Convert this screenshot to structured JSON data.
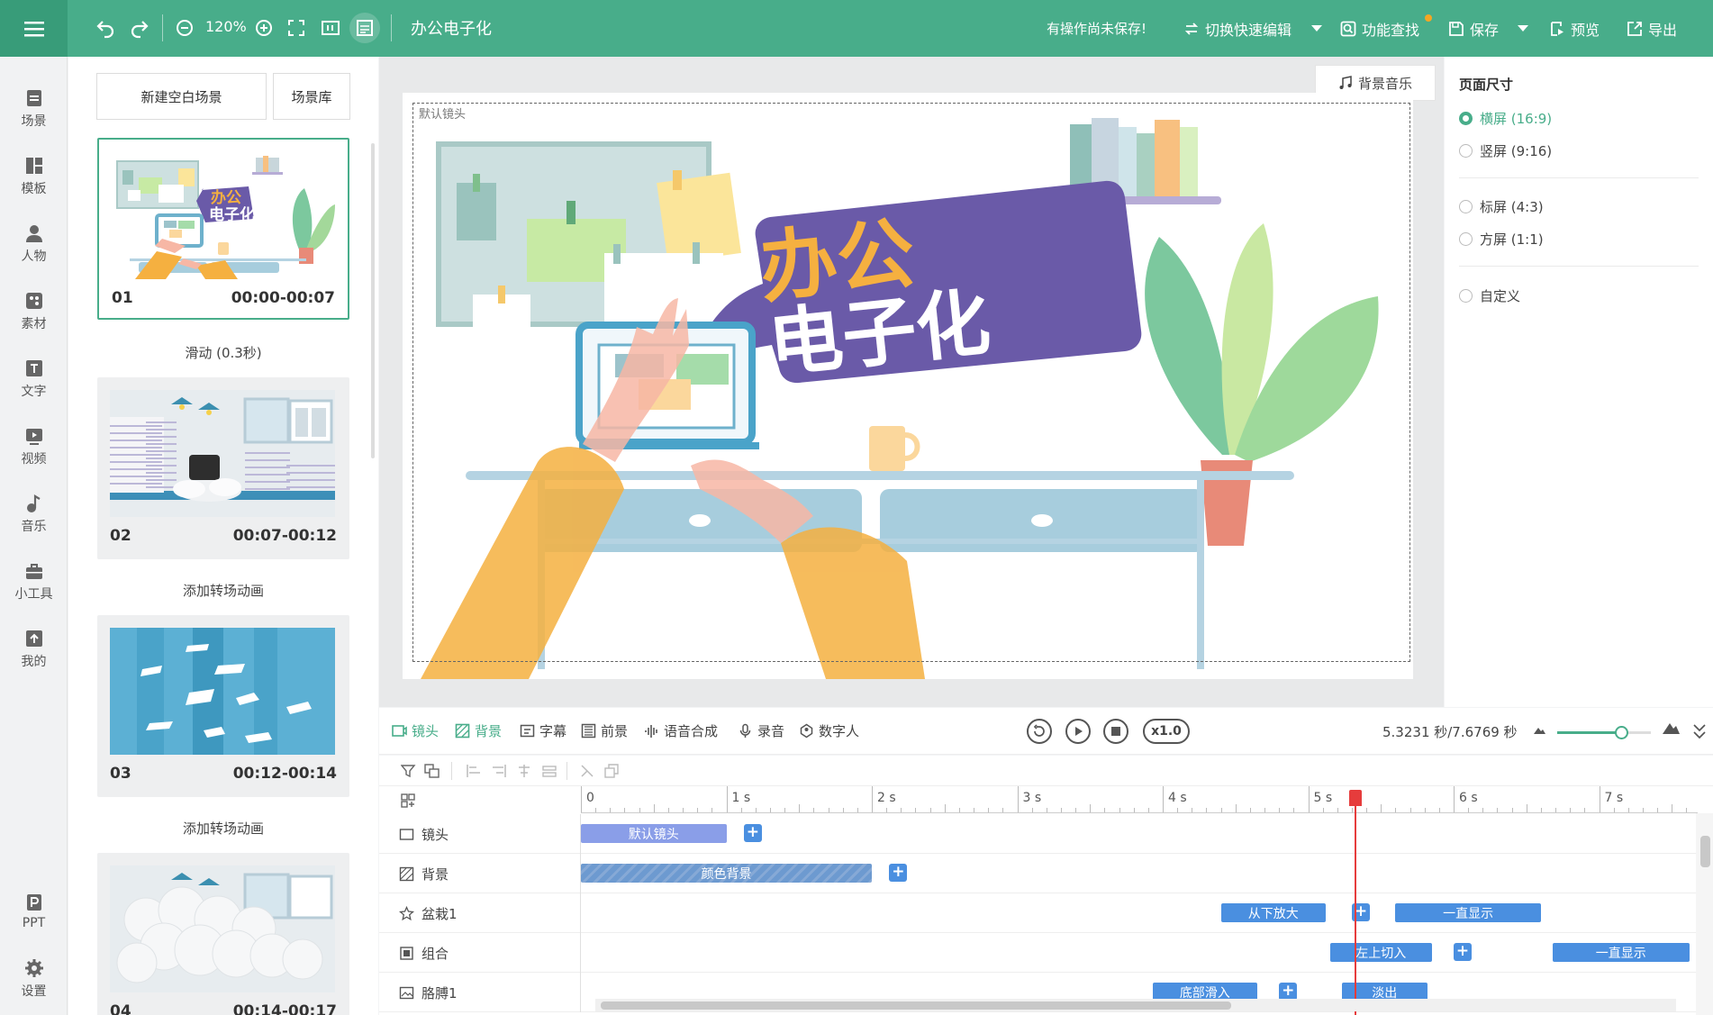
{
  "topbar": {
    "zoom": "120%",
    "doc_title": "办公电子化",
    "unsaved_notice": "有操作尚未保存!",
    "switch_label": "切换快速编辑",
    "find_label": "功能查找",
    "save_label": "保存",
    "preview_label": "预览",
    "export_label": "导出"
  },
  "nav": {
    "items": [
      {
        "label": "场景",
        "icon": "scene-icon"
      },
      {
        "label": "模板",
        "icon": "template-icon"
      },
      {
        "label": "人物",
        "icon": "person-icon"
      },
      {
        "label": "素材",
        "icon": "material-icon"
      },
      {
        "label": "文字",
        "icon": "text-icon"
      },
      {
        "label": "视频",
        "icon": "video-icon"
      },
      {
        "label": "音乐",
        "icon": "music-icon"
      },
      {
        "label": "小工具",
        "icon": "toolbox-icon"
      },
      {
        "label": "我的",
        "icon": "upload-icon"
      }
    ],
    "bottom": [
      {
        "label": "PPT",
        "icon": "ppt-icon"
      },
      {
        "label": "设置",
        "icon": "gear-icon"
      }
    ]
  },
  "scenes": {
    "new_blank": "新建空白场景",
    "library": "场景库",
    "cards": [
      {
        "num": "01",
        "time": "00:00-00:07",
        "transition": "滑动 (0.3秒)"
      },
      {
        "num": "02",
        "time": "00:07-00:12",
        "transition": "添加转场动画"
      },
      {
        "num": "03",
        "time": "00:12-00:14",
        "transition": "添加转场动画"
      },
      {
        "num": "04",
        "time": "00:14-00:17",
        "transition": ""
      }
    ],
    "thumb1_title_line1": "办公",
    "thumb1_title_line2": "电子化"
  },
  "canvas": {
    "bg_music": "背景音乐",
    "lens_label": "默认镜头",
    "title_line1": "办公",
    "title_line2": "电子化"
  },
  "page_size": {
    "title": "页面尺寸",
    "options": [
      {
        "label": "横屏 (16:9)",
        "selected": true
      },
      {
        "label": "竖屏 (9:16)",
        "selected": false
      },
      {
        "label": "标屏 (4:3)",
        "selected": false
      },
      {
        "label": "方屏 (1:1)",
        "selected": false
      },
      {
        "label": "自定义",
        "selected": false
      }
    ]
  },
  "timeline_toolbar": {
    "tabs": [
      {
        "label": "镜头",
        "active": true
      },
      {
        "label": "背景",
        "active": true
      },
      {
        "label": "字幕",
        "active": false
      },
      {
        "label": "前景",
        "active": false
      },
      {
        "label": "语音合成",
        "active": false
      },
      {
        "label": "录音",
        "active": false
      },
      {
        "label": "数字人",
        "active": false
      }
    ],
    "speed": "x1.0",
    "time_readout": "5.3231 秒/7.6769 秒",
    "zoom_level": 0.68
  },
  "timeline": {
    "ruler": [
      "0",
      "1 s",
      "2 s",
      "3 s",
      "4 s",
      "5 s",
      "6 s",
      "7 s"
    ],
    "playhead_seconds": 5.3231,
    "tracks": [
      {
        "label": "镜头",
        "clips": [
          {
            "label": "默认镜头",
            "start": 0,
            "end": 1.0,
            "style": "lens"
          }
        ],
        "plus_at": 1.12
      },
      {
        "label": "背景",
        "clips": [
          {
            "label": "颜色背景",
            "start": 0,
            "end": 2.0,
            "style": "bg"
          }
        ],
        "plus_at": 2.12
      },
      {
        "label": "盆栽1",
        "clips": [
          {
            "label": "从下放大",
            "start": 4.4,
            "end": 5.12,
            "style": "blue"
          },
          {
            "label": "一直显示",
            "start": 5.6,
            "end": 6.6,
            "style": "blue"
          }
        ],
        "plus_at": 5.3
      },
      {
        "label": "组合",
        "clips": [
          {
            "label": "左上切入",
            "start": 5.15,
            "end": 5.85,
            "style": "blue"
          },
          {
            "label": "一直显示",
            "start": 6.68,
            "end": 7.62,
            "style": "blue"
          }
        ],
        "plus_at": 6.0
      },
      {
        "label": "胳膊1",
        "clips": [
          {
            "label": "底部滑入",
            "start": 3.93,
            "end": 4.65,
            "style": "blue"
          },
          {
            "label": "淡出",
            "start": 5.23,
            "end": 5.82,
            "style": "blue"
          }
        ],
        "plus_at": 4.8
      }
    ]
  },
  "colors": {
    "accent": "#48ad8a",
    "clip_blue": "#4a8fe0",
    "lens_clip": "#8a9ee8",
    "bg_clip": "#6d9ad0",
    "purple": "#6a5aa8",
    "orange": "#f5b040"
  }
}
